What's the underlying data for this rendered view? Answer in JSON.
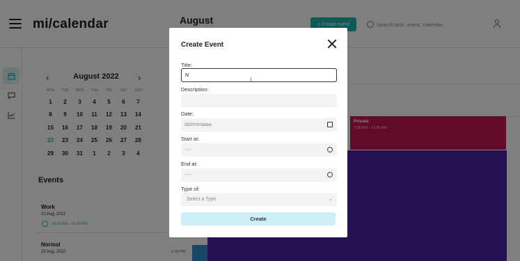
{
  "header": {
    "logo": "mi/calendar",
    "month": "August",
    "create_label": "+ Create event",
    "search_placeholder": "Search task, event, calendar"
  },
  "mini_calendar": {
    "title": "August 2022",
    "weekdays": [
      "MON",
      "TUE",
      "WED",
      "THU",
      "FRI",
      "SAT",
      "SUN"
    ],
    "weeks": [
      [
        "1",
        "2",
        "3",
        "4",
        "5",
        "6",
        "7"
      ],
      [
        "8",
        "9",
        "10",
        "11",
        "12",
        "13",
        "14"
      ],
      [
        "15",
        "16",
        "17",
        "18",
        "19",
        "20",
        "21"
      ],
      [
        "22",
        "23",
        "24",
        "25",
        "26",
        "27",
        "28"
      ],
      [
        "29",
        "30",
        "31",
        "1",
        "2",
        "3",
        "4"
      ]
    ],
    "today": "22"
  },
  "events": {
    "title": "Events",
    "items": [
      {
        "name": "Work",
        "date": "22 Aug, 2022",
        "time": "10:00 AM - 18:00 PM"
      },
      {
        "name": "Normal",
        "date": "22 Aug, 2022",
        "time": ""
      }
    ]
  },
  "calendar_view": {
    "private_block": {
      "title": "Private",
      "range": "7:30 AM  -  11:30 AM"
    },
    "time_label": "1:00 PM",
    "colors": {
      "accent": "#1fb5ad",
      "private": "#c3164e",
      "purple": "#4a22a8",
      "blue": "#2f8bcb"
    }
  },
  "modal": {
    "title": "Create Event",
    "title_label": "Title:",
    "title_value": "N",
    "description_label": "Description:",
    "date_label": "Date:",
    "date_placeholder": "dd/mm/aaaa",
    "start_label": "Start at:",
    "start_placeholder": "--:--",
    "end_label": "End at:",
    "end_placeholder": "--:--",
    "type_label": "Type of:",
    "type_placeholder": "Select a Type",
    "create_label": "Create"
  },
  "icons": {
    "menu": "hamburger-icon",
    "search": "search-icon",
    "user": "user-icon",
    "close": "close-icon",
    "rail": [
      "calendar-icon",
      "chat-icon",
      "chart-icon"
    ]
  }
}
